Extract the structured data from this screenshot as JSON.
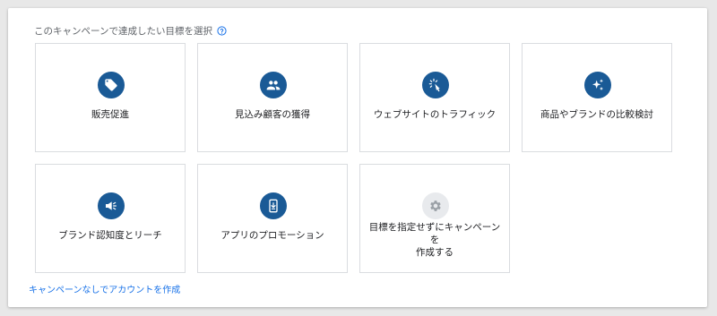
{
  "header": {
    "title": "このキャンペーンで達成したい目標を選択",
    "help_icon": "help-circle-icon"
  },
  "goals": [
    {
      "label": "販売促進",
      "icon": "tag-icon"
    },
    {
      "label": "見込み顧客の獲得",
      "icon": "people-icon"
    },
    {
      "label": "ウェブサイトのトラフィック",
      "icon": "cursor-click-icon"
    },
    {
      "label": "商品やブランドの比較検討",
      "icon": "sparkle-icon"
    },
    {
      "label": "ブランド認知度とリーチ",
      "icon": "megaphone-icon"
    },
    {
      "label": "アプリのプロモーション",
      "icon": "phone-download-icon"
    },
    {
      "label": "目標を指定せずにキャンペーンを\n作成する",
      "icon": "gear-icon"
    }
  ],
  "footer": {
    "link_text": "キャンペーンなしでアカウントを作成"
  },
  "colors": {
    "accent": "#1a5a96",
    "link": "#1a73e8",
    "border": "#dadce0"
  }
}
